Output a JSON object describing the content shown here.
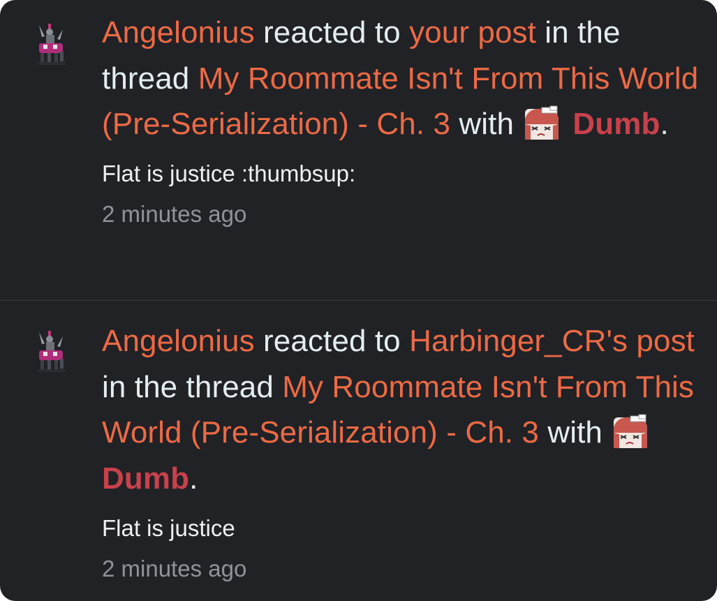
{
  "notifications": [
    {
      "actor": "Angelonius",
      "verb": " reacted to ",
      "post_link": "your post",
      "in_thread_text": " in the thread ",
      "thread_title": "My Roommate Isn't From This World (Pre-Serialization) - Ch. 3",
      "with_text": " with ",
      "reaction_name": "Dumb",
      "reaction_icon": "dumb-reaction-icon",
      "end_punct": ".",
      "snippet": "Flat is justice :thumbsup:",
      "time": "2 minutes ago"
    },
    {
      "actor": "Angelonius",
      "verb": " reacted to ",
      "post_link": "Harbinger_CR's post",
      "in_thread_text": " in the thread ",
      "thread_title": "My Roommate Isn't From This World (Pre-Serialization) - Ch. 3",
      "with_text": " with ",
      "reaction_name": "Dumb",
      "reaction_icon": "dumb-reaction-icon",
      "end_punct": ".",
      "snippet": "Flat is justice",
      "time": "2 minutes ago"
    }
  ],
  "colors": {
    "background": "#212226",
    "link": "#ec6a45",
    "reaction": "#c8414b",
    "text": "#e4edf0",
    "muted": "#8f9399"
  }
}
